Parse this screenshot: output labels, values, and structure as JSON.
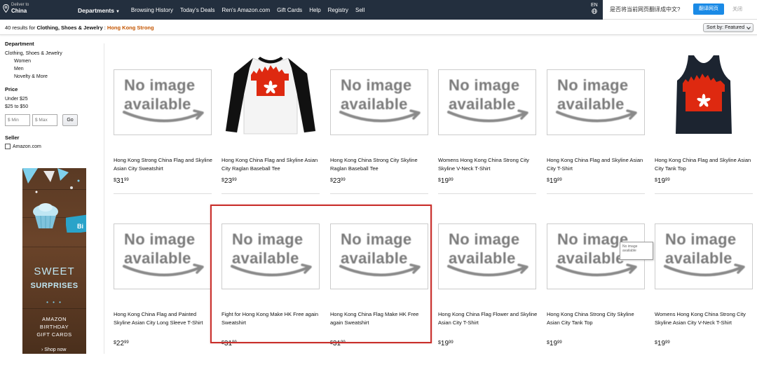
{
  "nav": {
    "deliver_line1": "Deliver to",
    "deliver_line2": "China",
    "departments": "Departments",
    "links": [
      "Browsing History",
      "Today's Deals",
      "Ren's Amazon.com",
      "Gift Cards",
      "Help",
      "Registry",
      "Sell"
    ],
    "lang": "EN"
  },
  "translate": {
    "prompt": "是否将当前网页翻译成中文?",
    "button": "翻译网页",
    "close": "关闭"
  },
  "results": {
    "count_text": "40 results for",
    "category": "Clothing, Shoes & Jewelry",
    "separator": ":",
    "keyword": "Hong Kong Strong"
  },
  "sort": {
    "label": "Sort by: Featured"
  },
  "sidebar": {
    "department_heading": "Department",
    "department_main": "Clothing, Shoes & Jewelry",
    "department_subs": [
      "Women",
      "Men",
      "Novelty & More"
    ],
    "price_heading": "Price",
    "price_ranges": [
      "Under $25",
      "$25 to $50"
    ],
    "min_placeholder": "$ Min",
    "max_placeholder": "$ Max",
    "go_label": "Go",
    "seller_heading": "Seller",
    "seller_option": "Amazon.com"
  },
  "ad": {
    "line1": "SWEET",
    "line2": "SURPRISES",
    "dots": "• • •",
    "line3": "AMAZON",
    "line4": "BIRTHDAY",
    "line5": "GIFT CARDS",
    "cta": "› Shop now",
    "tag_text": "Bi"
  },
  "no_image": {
    "line1": "No image",
    "line2": "available"
  },
  "products": [
    {
      "title": "Hong Kong Strong China Flag and Skyline Asian City Sweatshirt",
      "dollars": "31",
      "cents": "99",
      "image": "no-image"
    },
    {
      "title": "Hong Kong China Flag and Skyline Asian City Raglan Baseball Tee",
      "dollars": "23",
      "cents": "99",
      "image": "raglan-tee"
    },
    {
      "title": "Hong Kong China Strong City Skyline Raglan Baseball Tee",
      "dollars": "23",
      "cents": "99",
      "image": "no-image"
    },
    {
      "title": "Womens Hong Kong China Strong City Skyline V-Neck T-Shirt",
      "dollars": "19",
      "cents": "99",
      "image": "no-image"
    },
    {
      "title": "Hong Kong China Flag and Skyline Asian City T-Shirt",
      "dollars": "19",
      "cents": "99",
      "image": "no-image"
    },
    {
      "title": "Hong Kong China Flag and Skyline Asian City Tank Top",
      "dollars": "19",
      "cents": "99",
      "image": "tank-top"
    },
    {
      "title": "Hong Kong China Flag and Painted Skyline Asian City Long Sleeve T-Shirt",
      "dollars": "22",
      "cents": "99",
      "image": "no-image"
    },
    {
      "title": "Fight for Hong Kong Make HK Free again Sweatshirt",
      "dollars": "31",
      "cents": "99",
      "image": "no-image"
    },
    {
      "title": "Hong Kong China Flag Make HK Free again Sweatshirt",
      "dollars": "31",
      "cents": "99",
      "image": "no-image"
    },
    {
      "title": "Hong Kong China Flag Flower and Skyline Asian City T-Shirt",
      "dollars": "19",
      "cents": "99",
      "image": "no-image"
    },
    {
      "title": "Hong Kong China Strong City Skyline Asian City Tank Top",
      "dollars": "19",
      "cents": "99",
      "image": "no-image"
    },
    {
      "title": "Womens Hong Kong China Strong City Skyline Asian City V-Neck T-Shirt",
      "dollars": "19",
      "cents": "99",
      "image": "no-image"
    }
  ],
  "tooltip": {
    "line1": "No image",
    "line2": "available"
  },
  "colors": {
    "nav_bg": "#232f3e",
    "highlight": "#c9302c",
    "keyword": "#c45500",
    "translate_btn": "#1a8ae6",
    "hk_red": "#de2910"
  }
}
